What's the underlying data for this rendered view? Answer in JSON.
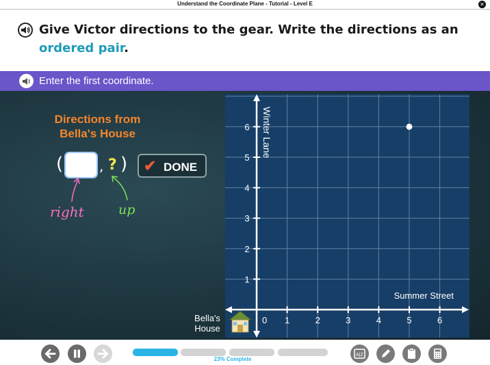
{
  "window": {
    "title": "Understand the Coordinate Plane - Tutorial - Level E",
    "close_icon": "close-icon"
  },
  "question": {
    "part1": "Give Victor directions to the gear. Write the directions as an",
    "highlight": "ordered pair",
    "end": "."
  },
  "instruction": "Enter the first coordinate.",
  "directions": {
    "title_line1": "Directions from",
    "title_line2": "Bella's House",
    "open_paren": "(",
    "input_value": "",
    "comma": ",",
    "second_value": "?",
    "close_paren": ")",
    "hint_right": "right",
    "hint_up": "up"
  },
  "done_button": {
    "label": "DONE",
    "icon": "checkmark-icon"
  },
  "graph": {
    "y_axis_label": "Winter Lane",
    "x_axis_label": "Summer Street",
    "origin_label": "0",
    "x_ticks": [
      "1",
      "2",
      "3",
      "4",
      "5",
      "6"
    ],
    "y_ticks": [
      "1",
      "2",
      "3",
      "4",
      "5",
      "6"
    ],
    "point": {
      "x": 5,
      "y": 6
    },
    "house_label_line1": "Bella's",
    "house_label_line2": "House"
  },
  "footer": {
    "progress_percent": 23,
    "progress_label": "23% Complete",
    "tools": [
      "glossary-icon",
      "pencil-icon",
      "clipboard-icon",
      "calculator-icon"
    ],
    "glossary_text": "A|Z"
  },
  "colors": {
    "accent": "#6b55c9",
    "highlight": "#1e9bb8",
    "title_orange": "#f4862c",
    "progress": "#2cb3e6"
  }
}
